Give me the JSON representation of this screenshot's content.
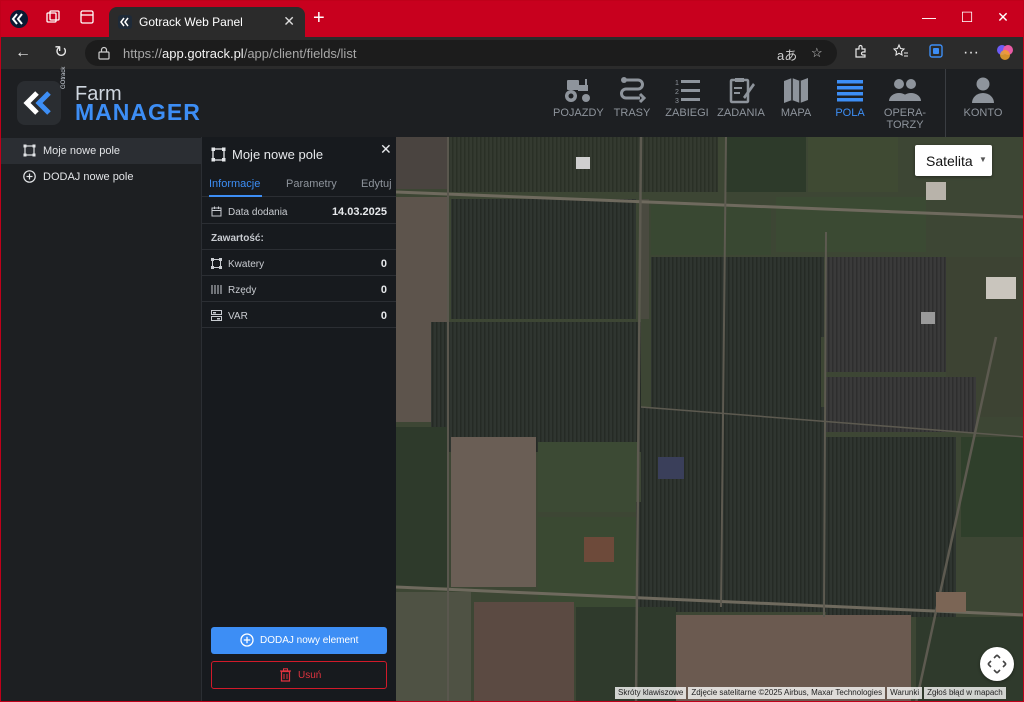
{
  "browser": {
    "tab_title": "Gotrack Web Panel",
    "url_scheme": "https://",
    "url_host": "app.gotrack.pl",
    "url_path": "/app/client/fields/list"
  },
  "app": {
    "brand_small": "GOtrack",
    "brand_top": "Farm",
    "brand_bottom": "MANAGER",
    "nav": [
      {
        "label": "POJAZDY",
        "icon": "tractor-icon"
      },
      {
        "label": "TRASY",
        "icon": "route-icon"
      },
      {
        "label": "ZABIEGI",
        "icon": "list-numbered-icon"
      },
      {
        "label": "ZADANIA",
        "icon": "task-edit-icon"
      },
      {
        "label": "MAPA",
        "icon": "map-icon"
      },
      {
        "label": "POLA",
        "icon": "fields-icon",
        "active": true
      },
      {
        "label_line1": "OPERA-",
        "label_line2": "TORZY",
        "icon": "operators-icon"
      },
      {
        "label": "KONTO",
        "icon": "account-icon"
      }
    ],
    "accent": "#3d8ef5",
    "danger": "#d11a2a"
  },
  "sidebar": {
    "items": [
      {
        "label": "Moje nowe pole",
        "icon": "polygon-icon",
        "selected": true
      },
      {
        "label": "DODAJ nowe pole",
        "icon": "plus-circle-icon"
      }
    ]
  },
  "panel": {
    "title": "Moje nowe pole",
    "tabs": [
      "Informacje",
      "Parametry",
      "Edytuj"
    ],
    "active_tab": "Informacje",
    "date_label": "Data dodania",
    "date_value": "14.03.2025",
    "content_header": "Zawartość:",
    "rows": [
      {
        "label": "Kwatery",
        "value": "0",
        "icon": "quarters-icon"
      },
      {
        "label": "Rzędy",
        "value": "0",
        "icon": "rows-icon"
      },
      {
        "label": "VAR",
        "value": "0",
        "icon": "var-icon"
      }
    ],
    "add_button": "DODAJ nowy element",
    "delete_button": "Usuń"
  },
  "map": {
    "type_selected": "Satelita",
    "attributions": [
      "Skróty klawiszowe",
      "Zdjęcie satelitarne ©2025 Airbus, Maxar Technologies",
      "Warunki",
      "Zgłoś błąd w mapach"
    ]
  }
}
